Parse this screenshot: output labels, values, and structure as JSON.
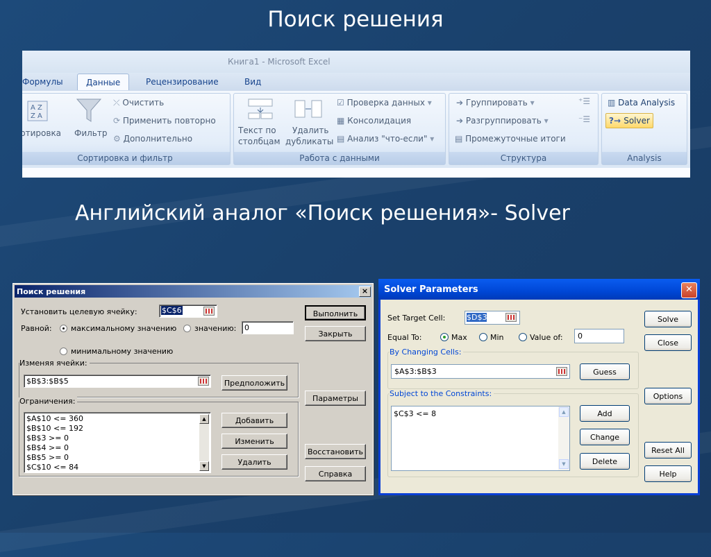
{
  "slide": {
    "title": "Поиск решения",
    "subtitle": "Английский аналог «Поиск решения»- Solver"
  },
  "ribbon": {
    "window_title": "Книга1 - Microsoft Excel",
    "tabs": [
      "Формулы",
      "Данные",
      "Рецензирование",
      "Вид"
    ],
    "active_tab": "Данные",
    "sort_filter": {
      "sort_label": "ртировка",
      "filter_label": "Фильтр",
      "clear": "Очистить",
      "reapply": "Применить повторно",
      "advanced": "Дополнительно",
      "group_label": "Сортировка и фильтр"
    },
    "data_tools": {
      "text_to_columns_1": "Текст по",
      "text_to_columns_2": "столбцам",
      "remove_duplicates_1": "Удалить",
      "remove_duplicates_2": "дубликаты",
      "validation": "Проверка данных",
      "consolidate": "Консолидация",
      "what_if": "Анализ \"что-если\"",
      "group_label": "Работа с данными"
    },
    "outline": {
      "group": "Группировать",
      "ungroup": "Разгруппировать",
      "subtotal": "Промежуточные итоги",
      "group_label": "Структура"
    },
    "analysis": {
      "data_analysis": "Data Analysis",
      "solver": "Solver",
      "group_label": "Analysis"
    }
  },
  "dialog_ru": {
    "title": "Поиск решения",
    "close": "×",
    "target_label": "Установить целевую ячейку:",
    "target_value": "$C$6",
    "equal_label": "Равной:",
    "max_label": "максимальному значению",
    "value_label": "значению:",
    "value_input": "0",
    "min_label": "минимальному значению",
    "changing_label": "Изменяя ячейки:",
    "changing_value": "$B$3:$B$5",
    "guess": "Предположить",
    "constraints_label": "Ограничения:",
    "constraints": [
      "$A$10 <= 360",
      "$B$10 <= 192",
      "$B$3 >= 0",
      "$B$4 >= 0",
      "$B$5 >= 0",
      "$C$10 <= 84"
    ],
    "add": "Добавить",
    "change": "Изменить",
    "delete": "Удалить",
    "solve": "Выполнить",
    "close_btn": "Закрыть",
    "options": "Параметры",
    "reset": "Восстановить",
    "help": "Справка"
  },
  "dialog_en": {
    "title": "Solver Parameters",
    "close": "✕",
    "target_label": "Set Target Cell:",
    "target_value": "$D$3",
    "equal_label": "Equal To:",
    "max_label": "Max",
    "min_label": "Min",
    "value_of_label": "Value of:",
    "value_input": "0",
    "changing_label": "By Changing Cells:",
    "changing_value": "$A$3:$B$3",
    "guess": "Guess",
    "constraints_label": "Subject to the Constraints:",
    "constraints": [
      "$C$3 <= 8"
    ],
    "add": "Add",
    "change": "Change",
    "delete": "Delete",
    "solve": "Solve",
    "close_btn": "Close",
    "options": "Options",
    "reset": "Reset All",
    "help": "Help"
  }
}
